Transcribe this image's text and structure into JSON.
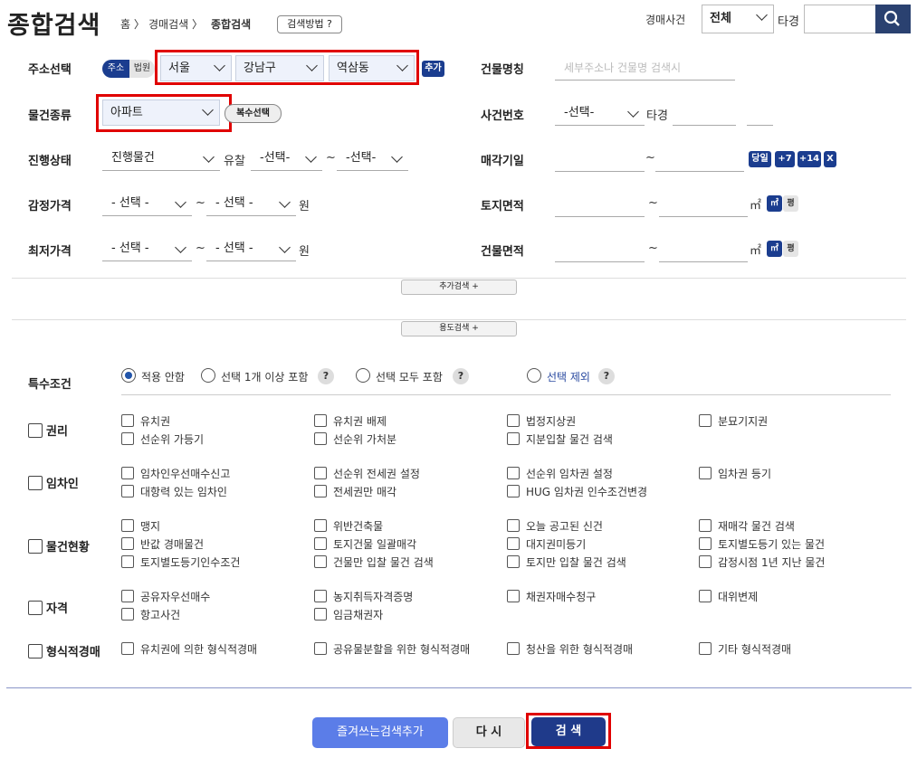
{
  "header": {
    "title": "종합검색",
    "crumb_home": "홈 〉",
    "crumb_auction": "경매검색 〉",
    "crumb_current": "종합검색",
    "help_button": "검색방법 ?",
    "case_label": "경매사건",
    "case_select": "전체",
    "case_suffix": "타경",
    "search_placeholder": "",
    "search_icon": "search-icon"
  },
  "address": {
    "label": "주소선택",
    "tab_address": "주소",
    "tab_court": "법원",
    "city": "서울",
    "district": "강남구",
    "dong": "역삼동",
    "add_button": "추가"
  },
  "building_name": {
    "label": "건물명칭",
    "placeholder": "세부주소나 건물명 검색시"
  },
  "property_type": {
    "label": "물건종류",
    "value": "아파트",
    "multi_button": "복수선택"
  },
  "case_number": {
    "label": "사건번호",
    "select": "-선택-",
    "suffix": "타경"
  },
  "progress": {
    "label": "진행상태",
    "status": "진행물건",
    "fail_label": "유찰",
    "from": "-선택-",
    "tilde": "~",
    "to": "-선택-"
  },
  "sale_date": {
    "label": "매각기일",
    "tilde": "~",
    "btn_today": "당일",
    "btn_7": "+7",
    "btn_14": "+14",
    "btn_x": "X"
  },
  "appraisal": {
    "label": "감정가격",
    "from": "- 선택 -",
    "tilde": "~",
    "to": "- 선택 -",
    "unit": "원"
  },
  "land_area": {
    "label": "토지면적",
    "tilde": "~",
    "unit": "㎡",
    "unit_m2": "㎡",
    "unit_pyeong": "평"
  },
  "min_price": {
    "label": "최저가격",
    "from": "- 선택 -",
    "tilde": "~",
    "to": "- 선택 -",
    "unit": "원"
  },
  "building_area": {
    "label": "건물면적",
    "tilde": "~",
    "unit": "㎡",
    "unit_m2": "㎡",
    "unit_pyeong": "평"
  },
  "more_search": "추가검색 +",
  "usage_search": "용도검색 +",
  "special": {
    "label": "특수조건",
    "options": [
      "적용 안함",
      "선택 1개 이상 포함",
      "선택 모두 포함",
      "선택 제외"
    ]
  },
  "groups": {
    "rights": {
      "label": "권리",
      "items": [
        "유치권",
        "유치권 배제",
        "법정지상권",
        "분묘기지권",
        "선순위 가등기",
        "선순위 가처분",
        "지분입찰 물건 검색"
      ]
    },
    "tenant": {
      "label": "임차인",
      "items": [
        "임차인우선매수신고",
        "선순위 전세권 설정",
        "선순위 임차권 설정",
        "임차권 등기",
        "대항력 있는 임차인",
        "전세권만 매각",
        "HUG 임차권 인수조건변경"
      ]
    },
    "status": {
      "label": "물건현황",
      "items": [
        "맹지",
        "위반건축물",
        "오늘 공고된 신건",
        "재매각 물건 검색",
        "반값 경매물건",
        "토지건물 일괄매각",
        "대지권미등기",
        "토지별도등기 있는 물건",
        "토지별도등기인수조건",
        "건물만 입찰 물건 검색",
        "토지만 입찰 물건 검색",
        "감정시점 1년 지난 물건"
      ]
    },
    "qualification": {
      "label": "자격",
      "items": [
        "공유자우선매수",
        "농지취득자격증명",
        "채권자매수청구",
        "대위변제",
        "항고사건",
        "임금채권자"
      ]
    },
    "formal": {
      "label": "형식적경매",
      "items": [
        "유치권에 의한 형식적경매",
        "공유물분할을 위한 형식적경매",
        "청산을 위한 형식적경매",
        "기타 형식적경매"
      ]
    }
  },
  "footer": {
    "favorite": "즐겨쓰는검색추가",
    "reset": "다 시",
    "search": "검 색"
  }
}
